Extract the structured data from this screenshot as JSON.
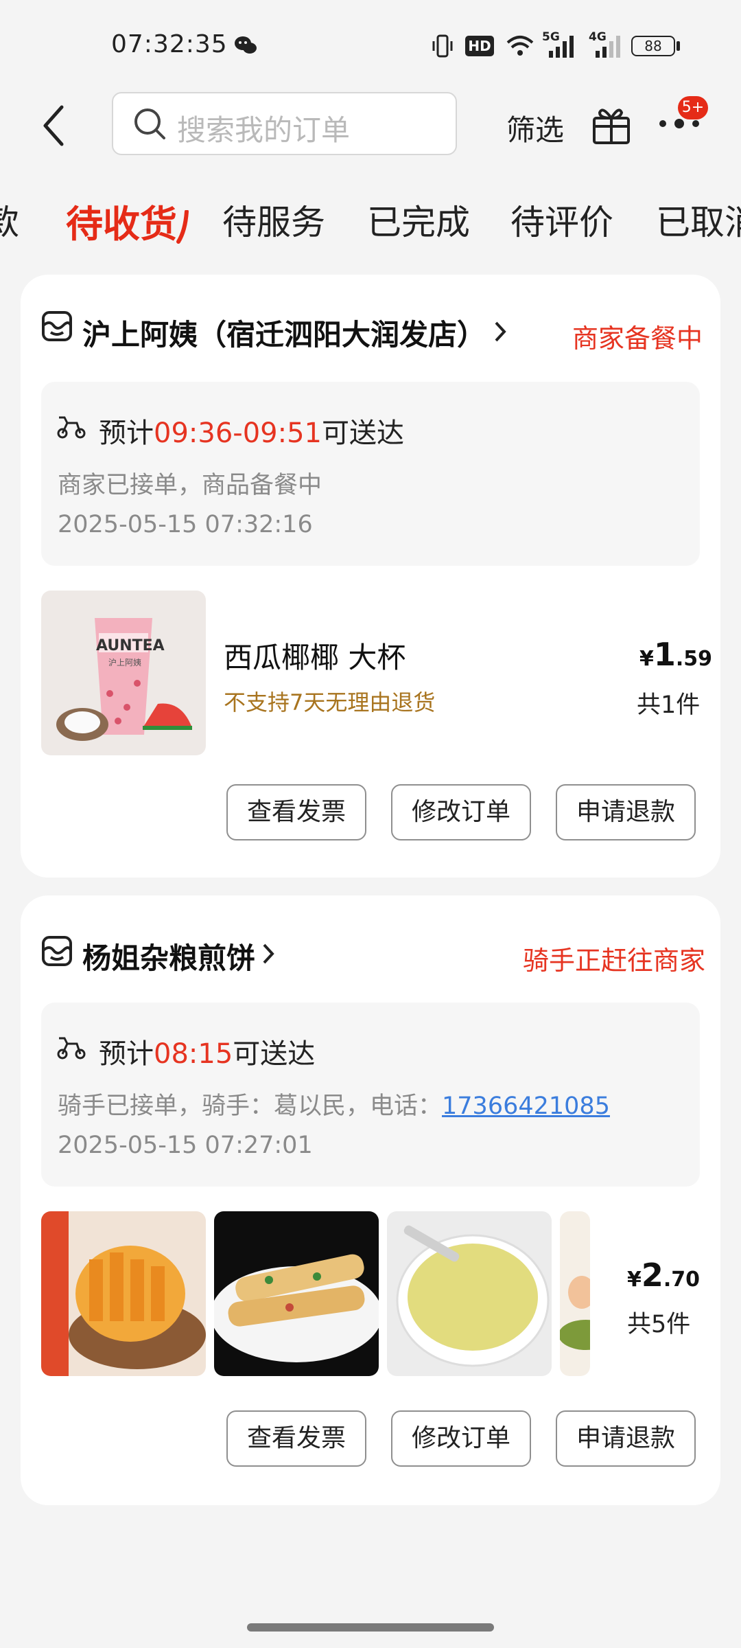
{
  "status_bar": {
    "time": "07:32:35",
    "hd_label": "HD",
    "net_5g": "5G",
    "net_4g": "4G",
    "battery": "88"
  },
  "header": {
    "search_placeholder": "搜索我的订单",
    "filter_label": "筛选",
    "badge": "5+"
  },
  "tabs": [
    {
      "label": "款"
    },
    {
      "label": "待收货"
    },
    {
      "label": "待服务"
    },
    {
      "label": "已完成"
    },
    {
      "label": "待评价"
    },
    {
      "label": "已取消"
    }
  ],
  "orders": [
    {
      "shop_name": "沪上阿姨（宿迁泗阳大润发店）",
      "status": "商家备餐中",
      "eta_prefix": "预计",
      "eta_time": "09:36-09:51",
      "eta_suffix": "可送达",
      "progress": "商家已接单，商品备餐中",
      "timestamp": "2025-05-15 07:32:16",
      "item_name": "西瓜椰椰 大杯",
      "item_note": "不支持7天无理由退货",
      "thumb_brand": "AUNTEA",
      "thumb_sub": "沪上阿姨",
      "price_symbol": "¥",
      "price_int": "1",
      "price_dec": ".59",
      "count": "共1件",
      "buttons": {
        "invoice": "查看发票",
        "modify": "修改订单",
        "refund": "申请退款"
      }
    },
    {
      "shop_name": "杨姐杂粮煎饼",
      "status": "骑手正赶往商家",
      "eta_prefix": "预计",
      "eta_time": "08:15",
      "eta_suffix": "可送达",
      "progress_prefix": "骑手已接单，骑手：葛以民，电话：",
      "phone": "17366421085",
      "timestamp": "2025-05-15 07:27:01",
      "price_symbol": "¥",
      "price_int": "2",
      "price_dec": ".70",
      "count": "共5件",
      "buttons": {
        "invoice": "查看发票",
        "modify": "修改订单",
        "refund": "申请退款"
      }
    }
  ],
  "colors": {
    "accent": "#e63421",
    "link": "#3b7ddd",
    "note": "#a8741f"
  }
}
